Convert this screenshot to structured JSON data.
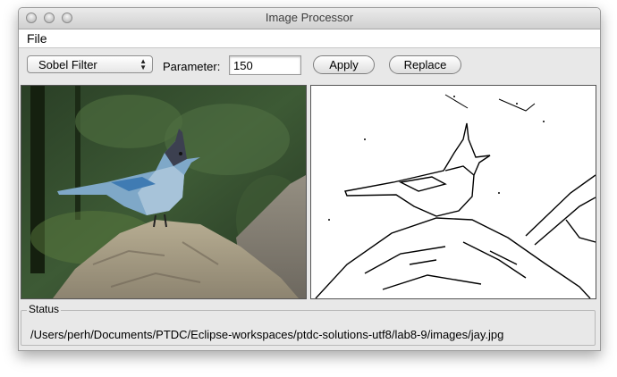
{
  "window": {
    "title": "Image Processor"
  },
  "menu": {
    "file": "File"
  },
  "toolbar": {
    "filter_selected": "Sobel Filter",
    "parameter_label": "Parameter:",
    "parameter_value": "150",
    "apply_label": "Apply",
    "replace_label": "Replace"
  },
  "images": {
    "original_icon": "photo-original-image",
    "processed_icon": "edge-detected-image"
  },
  "status": {
    "title": "Status",
    "text": "/Users/perh/Documents/PTDC/Eclipse-workspaces/ptdc-solutions-utf8/lab8-9/images/jay.jpg"
  }
}
